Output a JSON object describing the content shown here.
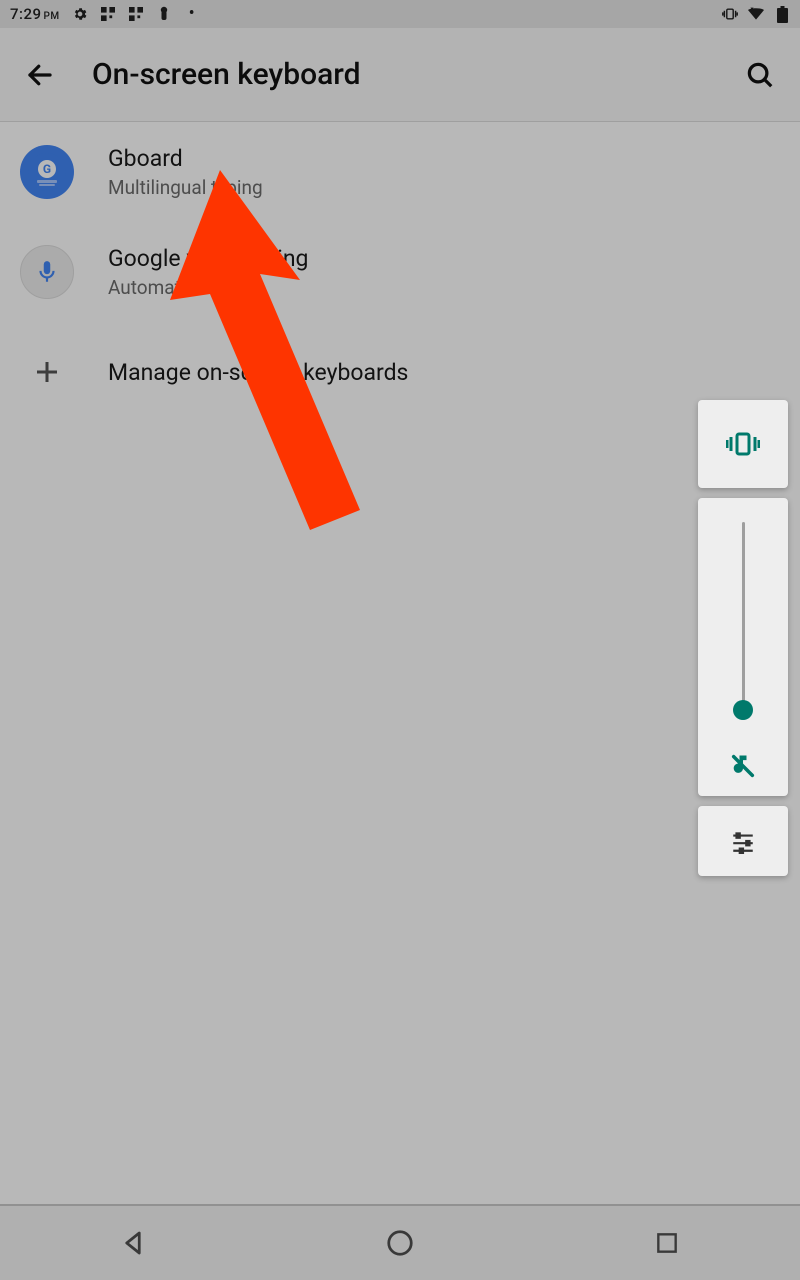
{
  "status": {
    "time": "7:29",
    "ampm": "PM"
  },
  "appbar": {
    "title": "On-screen keyboard"
  },
  "items": [
    {
      "title": "Gboard",
      "subtitle": "Multilingual typing"
    },
    {
      "title": "Google voice typing",
      "subtitle": "Automatic"
    },
    {
      "title": "Manage on-screen keyboards",
      "subtitle": ""
    }
  ],
  "colors": {
    "accent": "#00796b",
    "arrow": "#fe3400"
  }
}
